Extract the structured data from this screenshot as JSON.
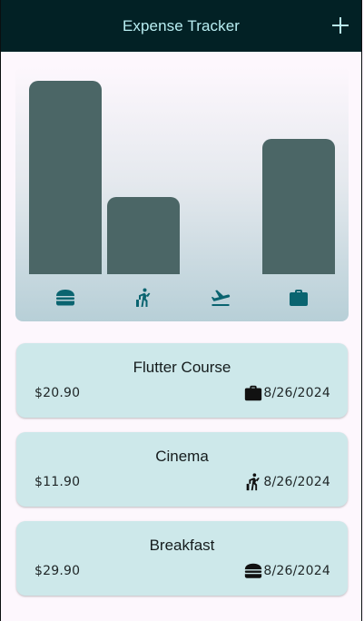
{
  "appbar": {
    "title": "Expense Tracker",
    "add_icon": "plus-icon"
  },
  "colors": {
    "appbar_bg": "#022125",
    "title_color": "#b9eef2",
    "bar_color": "#4b6666",
    "chart_icon_color": "#0a6470",
    "card_bg": "#cde8ea",
    "page_bg": "#fdf7fd"
  },
  "chart_data": {
    "type": "bar",
    "categories": [
      "food",
      "leisure",
      "travel",
      "work"
    ],
    "category_icons": [
      "hamburger-icon",
      "leisure-person-icon",
      "flight-takeoff-icon",
      "briefcase-icon"
    ],
    "values": [
      29.9,
      11.9,
      0,
      20.9
    ],
    "ylim": [
      0,
      29.9
    ],
    "xlabel": "",
    "ylabel": ""
  },
  "expenses": [
    {
      "title": "Flutter Course",
      "amount": "$20.90",
      "date": "8/26/2024",
      "icon": "briefcase-icon"
    },
    {
      "title": "Cinema",
      "amount": "$11.90",
      "date": "8/26/2024",
      "icon": "leisure-person-icon"
    },
    {
      "title": "Breakfast",
      "amount": "$29.90",
      "date": "8/26/2024",
      "icon": "hamburger-icon"
    }
  ]
}
